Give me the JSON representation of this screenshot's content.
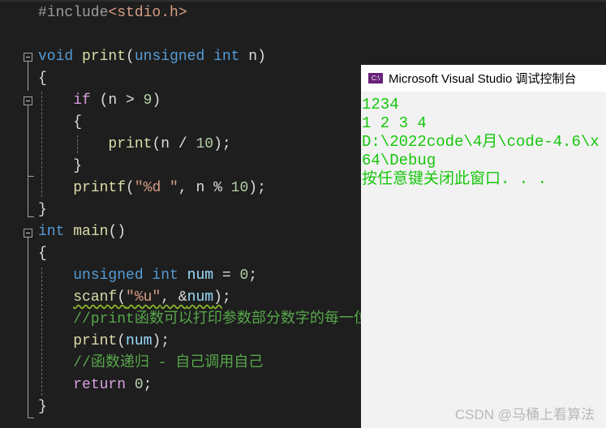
{
  "editor": {
    "lines": [
      [
        [
          "pp",
          "#include"
        ],
        [
          "inc",
          "<stdio.h>"
        ]
      ],
      [],
      [
        [
          "kw",
          "void"
        ],
        [
          "pl",
          " "
        ],
        [
          "fn",
          "print"
        ],
        [
          "pl",
          "("
        ],
        [
          "kw",
          "unsigned int"
        ],
        [
          "pl",
          " "
        ],
        [
          "pl",
          "n)"
        ]
      ],
      [
        [
          "pl",
          "{"
        ]
      ],
      [
        [
          "pl",
          "    "
        ],
        [
          "ctl",
          "if"
        ],
        [
          "pl",
          " (n > "
        ],
        [
          "num",
          "9"
        ],
        [
          "pl",
          ")"
        ]
      ],
      [
        [
          "pl",
          "    {"
        ]
      ],
      [
        [
          "pl",
          "        "
        ],
        [
          "fn",
          "print"
        ],
        [
          "pl",
          "(n / "
        ],
        [
          "num",
          "10"
        ],
        [
          "pl",
          ");"
        ]
      ],
      [
        [
          "pl",
          "    }"
        ]
      ],
      [
        [
          "pl",
          "    "
        ],
        [
          "fn",
          "printf"
        ],
        [
          "pl",
          "("
        ],
        [
          "str",
          "\"%d \""
        ],
        [
          "pl",
          ", n % "
        ],
        [
          "num",
          "10"
        ],
        [
          "pl",
          ");"
        ]
      ],
      [
        [
          "pl",
          "}"
        ]
      ],
      [
        [
          "kw",
          "int"
        ],
        [
          "pl",
          " "
        ],
        [
          "fn",
          "main"
        ],
        [
          "pl",
          "()"
        ]
      ],
      [
        [
          "pl",
          "{"
        ]
      ],
      [
        [
          "pl",
          "    "
        ],
        [
          "kw",
          "unsigned int"
        ],
        [
          "pl",
          " "
        ],
        [
          "var",
          "num"
        ],
        [
          "pl",
          " = "
        ],
        [
          "num",
          "0"
        ],
        [
          "pl",
          ";"
        ]
      ],
      [
        [
          "pl",
          "    "
        ],
        [
          "fn squig",
          "scanf"
        ],
        [
          "pl squig",
          "("
        ],
        [
          "str squig",
          "\"%u\""
        ],
        [
          "pl squig",
          ", &"
        ],
        [
          "var squig",
          "num"
        ],
        [
          "pl squig",
          ")"
        ],
        [
          "pl",
          ";"
        ]
      ],
      [
        [
          "pl",
          "    "
        ],
        [
          "cm",
          "//print函数可以打印参数部分数字的每一位"
        ]
      ],
      [
        [
          "pl",
          "    "
        ],
        [
          "fn",
          "print"
        ],
        [
          "pl",
          "("
        ],
        [
          "var",
          "num"
        ],
        [
          "pl",
          ");"
        ]
      ],
      [
        [
          "pl",
          "    "
        ],
        [
          "cm",
          "//函数递归 - 自己调用自己"
        ]
      ],
      [
        [
          "pl",
          "    "
        ],
        [
          "ctl",
          "return"
        ],
        [
          "pl",
          " "
        ],
        [
          "num",
          "0"
        ],
        [
          "pl",
          ";"
        ]
      ],
      [
        [
          "pl",
          "}"
        ]
      ]
    ]
  },
  "console": {
    "title": "Microsoft Visual Studio 调试控制台",
    "icon_label": "C:\\",
    "output": [
      "1234",
      "1 2 3 4",
      "D:\\2022code\\4月\\code-4.6\\x64\\Debug",
      "按任意键关闭此窗口. . ."
    ]
  },
  "watermark": "CSDN @马桶上看算法"
}
